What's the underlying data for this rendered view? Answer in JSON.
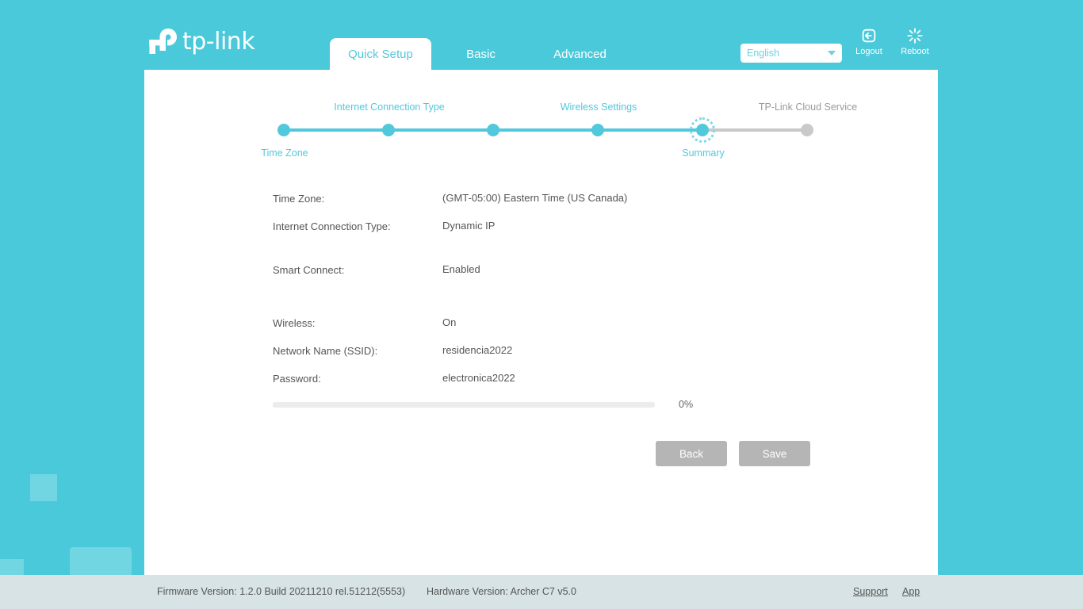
{
  "brand": {
    "name": "tp-link",
    "logo_icon": "tp-link-logo-icon",
    "accent_color": "#52c8dc",
    "background_color": "#4ac9da"
  },
  "header": {
    "tabs": [
      {
        "label": "Quick Setup",
        "active": true
      },
      {
        "label": "Basic",
        "active": false
      },
      {
        "label": "Advanced",
        "active": false
      }
    ],
    "language": {
      "selected": "English",
      "options": [
        "English"
      ],
      "caret_icon": "chevron-down-icon"
    },
    "actions": [
      {
        "label": "Logout",
        "icon": "logout-icon"
      },
      {
        "label": "Reboot",
        "icon": "reboot-icon"
      }
    ]
  },
  "stepper": {
    "steps": [
      {
        "label": "Time Zone",
        "position": "bottom",
        "state": "done"
      },
      {
        "label": "Internet Connection Type",
        "position": "top",
        "state": "done"
      },
      {
        "label": "",
        "position": "top",
        "state": "done"
      },
      {
        "label": "Wireless Settings",
        "position": "top",
        "state": "done"
      },
      {
        "label": "Summary",
        "position": "bottom",
        "state": "current"
      },
      {
        "label": "TP-Link Cloud Service",
        "position": "top",
        "state": "todo"
      }
    ]
  },
  "summary": {
    "rows": [
      {
        "key": "Time Zone:",
        "value": "(GMT-05:00) Eastern Time (US Canada)"
      },
      {
        "key": "Internet Connection Type:",
        "value": "Dynamic IP"
      },
      {
        "key": "Smart Connect:",
        "value": "Enabled"
      },
      {
        "key": "Wireless:",
        "value": "On"
      },
      {
        "key": "Network Name (SSID):",
        "value": "residencia2022"
      },
      {
        "key": "Password:",
        "value": "electronica2022"
      }
    ]
  },
  "progress": {
    "percent_label": "0%",
    "percent_value": 0
  },
  "buttons": {
    "back": "Back",
    "save": "Save"
  },
  "footer": {
    "firmware": "Firmware Version: 1.2.0 Build 20211210 rel.51212(5553)",
    "hardware": "Hardware Version: Archer C7 v5.0",
    "support": "Support",
    "app": "App"
  }
}
